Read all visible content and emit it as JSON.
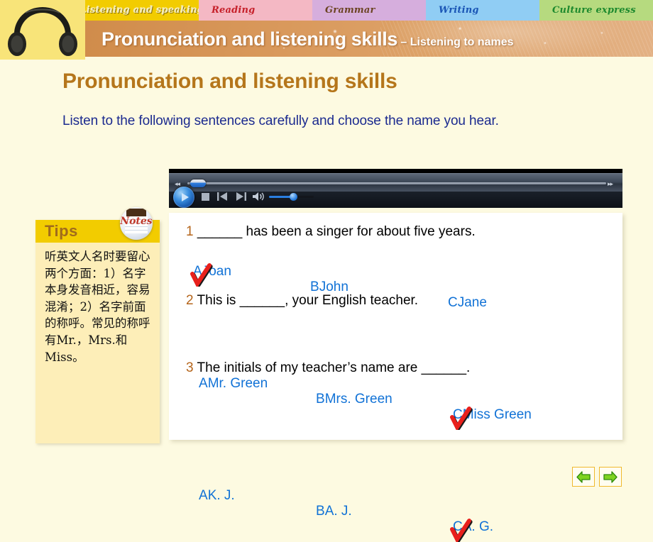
{
  "header": {
    "logo_icon": "headphones-icon",
    "tabs": [
      {
        "label": "Listening and speaking",
        "color": "#f2cc00",
        "text_color": "#f5eab0",
        "active": true
      },
      {
        "label": "Reading",
        "color": "#f4b8c4",
        "text_color": "#c6202a",
        "active": false
      },
      {
        "label": "Grammar",
        "color": "#d6aedd",
        "text_color": "#6b4423",
        "active": false
      },
      {
        "label": "Writing",
        "color": "#90cdf4",
        "text_color": "#1a55b5",
        "active": false
      },
      {
        "label": "Culture express",
        "color": "#b6da7f",
        "text_color": "#1e8a2e",
        "active": false
      }
    ],
    "banner_title": "Pronunciation and listening skills",
    "banner_dash": " – ",
    "banner_subtitle": "Listening to names"
  },
  "page": {
    "title": "Pronunciation and listening skills",
    "lead": "Listen to the following sentences carefully and choose the name you hear."
  },
  "player": {
    "rewind_glyph": "◂◂",
    "forward_glyph": "▸▸",
    "play_label": "play-button",
    "stop_label": "stop-button",
    "previous_label": "previous-track-button",
    "next_label": "next-track-button",
    "volume_label": "volume-icon"
  },
  "tips": {
    "badge_label": "Notes",
    "title": "Tips",
    "body": "听英文人名时要留心两个方面：1）名字本身发音相近，容易混淆；2）名字前面的称呼。常见的称呼有Mr.，Mrs.和Miss。"
  },
  "exercise": {
    "questions": [
      {
        "number": "1",
        "text": "______ has been a singer for about five years.",
        "options": [
          {
            "letter": "A",
            "text": "Joan",
            "checked": true
          },
          {
            "letter": "B",
            "text": "John",
            "checked": false
          },
          {
            "letter": "C",
            "text": "Jane",
            "checked": false
          }
        ]
      },
      {
        "number": "2",
        "text": "This is ______, your English teacher.",
        "options": [
          {
            "letter": "A",
            "text": "Mr. Green",
            "checked": false
          },
          {
            "letter": "B",
            "text": "Mrs. Green",
            "checked": false
          },
          {
            "letter": "C",
            "text": "Miss Green",
            "checked": true
          }
        ]
      },
      {
        "number": "3",
        "text": "The initials of my teacher’s name are ______.",
        "options": [
          {
            "letter": "A",
            "text": "K. J.",
            "checked": false
          },
          {
            "letter": "B",
            "text": "A. J.",
            "checked": false
          },
          {
            "letter": "C",
            "text": "A. G.",
            "checked": true
          }
        ]
      }
    ]
  },
  "footer": {
    "prev_label": "previous-slide",
    "next_label": "next-slide"
  },
  "colors": {
    "page_background": "#fdfae1",
    "banner": "#d9995c",
    "heading": "#b5761b",
    "lead_text": "#1b2a8f",
    "option_text": "#1172d6",
    "question_number": "#b5651b",
    "check_mark": "#e8201c",
    "tips_header": "#f2cc00",
    "tips_body_bg": "#fdeeb8",
    "arrow_green": "#4fae23"
  }
}
